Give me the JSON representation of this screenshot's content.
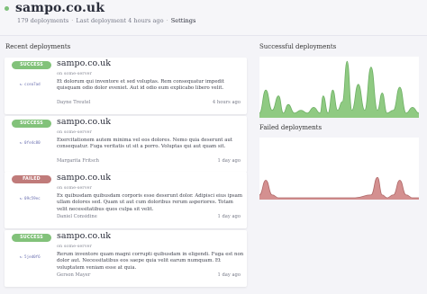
{
  "header": {
    "title": "sampo.co.uk",
    "deployments_count": "179 deployments",
    "last_deployment": "Last deployment 4 hours ago",
    "settings_link": "Settings",
    "status_color": "#7ec07a"
  },
  "sections": {
    "recent": "Recent deployments",
    "successful": "Successful deployments",
    "failed": "Failed deployments"
  },
  "deployments": [
    {
      "status": "SUCCESS",
      "commit": "↻ ccea7ad",
      "site": "sampo.co.uk",
      "server": "on some-server",
      "message": "Et dolorum qui inventore et sed voluptas. Rem consequatur impedit quisquam odio dolor eveniet. Aut id odio eum explicabo libero velit.",
      "author": "Dayne Treutel",
      "time": "4 hours ago"
    },
    {
      "status": "SUCCESS",
      "commit": "↻ 0fe4c80",
      "site": "sampo.co.uk",
      "server": "on some-server",
      "message": "Exercitationem autem minima vel eos dolores. Nemo quia deserunt aut consequatur. Fuga veritatis ut sit a porro. Voluptas qui aut quam sit.",
      "author": "Margarita Fritsch",
      "time": "1 day ago"
    },
    {
      "status": "FAILED",
      "commit": "↻ 09c59ec",
      "site": "sampo.co.uk",
      "server": "on some-server",
      "message": "Ex quibusdam quibusdam corporis esse deserunt dolor. Adipisci eius ipsam ullam dolores sed. Quam ut aut cum doloribus rerum asperiores. Totam velit necessitatibus quos culpa sit velit.",
      "author": "Daniel Considine",
      "time": "1 day ago"
    },
    {
      "status": "SUCCESS",
      "commit": "↻ 5jed0f6",
      "site": "sampo.co.uk",
      "server": "on some-server",
      "message": "Rerum inventore quam magni corrupti quibusdam in eligendi. Fuga est non dolor aut. Necessitatibus eos saepe quia velit earum numquam. Et voluptatem veniam esse at quia.",
      "author": "Gerson Mayer",
      "time": "1 day ago"
    }
  ],
  "chart_data": [
    {
      "type": "area",
      "title": "Successful deployments",
      "color": "#8fca82",
      "stroke": "#6fb066",
      "ylim": [
        0,
        1
      ],
      "x": [
        0,
        0.04,
        0.08,
        0.12,
        0.15,
        0.18,
        0.22,
        0.26,
        0.3,
        0.34,
        0.38,
        0.4,
        0.43,
        0.46,
        0.49,
        0.52,
        0.55,
        0.58,
        0.62,
        0.66,
        0.7,
        0.74,
        0.77,
        0.8,
        0.84,
        0.88,
        0.92,
        0.96,
        1.0
      ],
      "values": [
        0.05,
        0.45,
        0.1,
        0.35,
        0.05,
        0.2,
        0.05,
        0.1,
        0.05,
        0.15,
        0.05,
        0.35,
        0.05,
        0.45,
        0.1,
        0.25,
        0.95,
        0.1,
        0.55,
        0.1,
        0.85,
        0.1,
        0.4,
        0.05,
        0.1,
        0.5,
        0.05,
        0.15,
        0.05
      ]
    },
    {
      "type": "area",
      "title": "Failed deployments",
      "color": "#d49090",
      "stroke": "#b06a6a",
      "ylim": [
        0,
        1
      ],
      "x": [
        0,
        0.04,
        0.08,
        0.12,
        0.2,
        0.3,
        0.4,
        0.5,
        0.6,
        0.7,
        0.74,
        0.77,
        0.8,
        0.84,
        0.88,
        0.92,
        0.96,
        1.0
      ],
      "values": [
        0.05,
        0.3,
        0.05,
        0.0,
        0.0,
        0.0,
        0.0,
        0.0,
        0.0,
        0.05,
        0.35,
        0.05,
        0.0,
        0.05,
        0.3,
        0.05,
        0.0,
        0.0
      ]
    }
  ]
}
